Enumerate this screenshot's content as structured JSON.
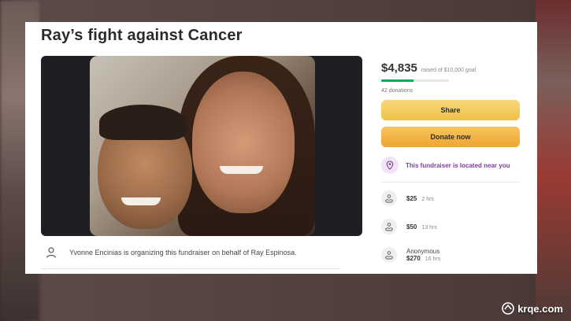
{
  "fundraiser": {
    "title": "Ray’s fight against Cancer",
    "organizer_text": "Yvonne Encinias is organizing this fundraiser on behalf of Ray Espinosa."
  },
  "sidebar": {
    "amount_raised": "$4,835",
    "goal_text": "raised of $10,000 goal",
    "progress": 0.48,
    "donations_count": "42 donations",
    "share_label": "Share",
    "donate_label": "Donate now",
    "location_text": "This fundraiser is located near you",
    "donors": [
      {
        "name": "",
        "amount": "$25",
        "time": "2 hrs"
      },
      {
        "name": "",
        "amount": "$50",
        "time": "13 hrs"
      },
      {
        "name": "Anonymous",
        "amount": "$270",
        "time": "16 hrs"
      }
    ]
  },
  "watermark": {
    "text": "krqe.com"
  },
  "colors": {
    "progress": "#02a95c",
    "share_button": "#f0c048",
    "donate_button": "#efa530",
    "location_accent": "#7a3e93"
  },
  "icons": {
    "organizer": "person-icon",
    "location": "location-pin-icon",
    "donor": "donation-hands-icon"
  }
}
